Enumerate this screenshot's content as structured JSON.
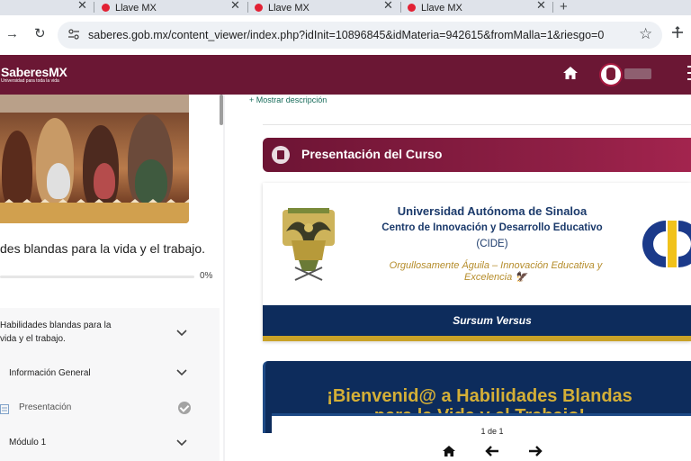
{
  "browser": {
    "tabs": [
      {
        "title": "Llave MX"
      },
      {
        "title": "Llave MX"
      },
      {
        "title": "Llave MX"
      }
    ],
    "url": "saberes.gob.mx/content_viewer/index.php?idInit=10896845&idMateria=942615&fromMalla=1&riesgo=0"
  },
  "site": {
    "logo": "SaberesMX",
    "tagline": "Universidad para toda la vida",
    "brand_color": "#6b1734"
  },
  "sidebar": {
    "course_title": "des blandas para la vida y el trabajo.",
    "progress_pct": "0%",
    "progress_value": 0,
    "modules": [
      {
        "label_line1": "Habilidades blandas para la",
        "label_line2": "vida y el trabajo."
      },
      {
        "label": "Información General"
      },
      {
        "label": "Presentación"
      },
      {
        "label": "Módulo 1"
      }
    ]
  },
  "main": {
    "show_description": "+ Mostrar descripción",
    "section_title": "Presentación del Curso",
    "card": {
      "university": "Universidad Autónoma de Sinaloa",
      "center": "Centro de Innovación y Desarrollo Educativo",
      "acronym": "(CIDE)",
      "motto": "Orgullosamente Águila – Innovación Educativa y Excelencia 🦅",
      "banner": "Sursum Versus"
    },
    "welcome": {
      "line1": "¡Bienvenid@ a Habilidades Blandas",
      "line2": "para la Vida y el Trabajo!"
    },
    "viewer": {
      "page_count": "1 de 1"
    }
  }
}
